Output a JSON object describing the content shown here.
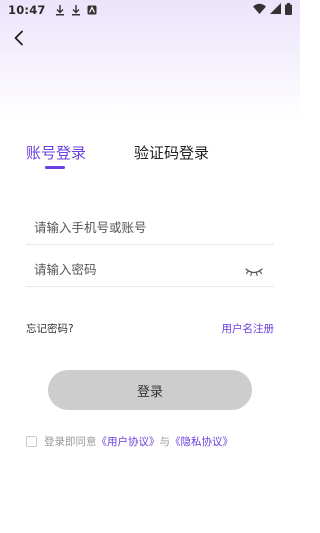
{
  "status_bar": {
    "time": "10:47",
    "left_icons": [
      "download-icon",
      "download-icon",
      "app-notification-icon"
    ],
    "right_icons": [
      "wifi-icon",
      "signal-icon",
      "battery-icon"
    ]
  },
  "nav": {
    "back_icon": "chevron-left-icon"
  },
  "tabs": [
    {
      "label": "账号登录",
      "active": true
    },
    {
      "label": "验证码登录",
      "active": false
    }
  ],
  "form": {
    "phone_placeholder": "请输入手机号或账号",
    "phone_value": "",
    "password_placeholder": "请输入密码",
    "password_value": "",
    "password_toggle_icon": "eye-closed-icon"
  },
  "links": {
    "forgot_password": "忘记密码?",
    "register": "用户名注册"
  },
  "login_button": {
    "label": "登录"
  },
  "agreement": {
    "prefix": "登录即同意",
    "user_agreement": "《用户协议》",
    "connector": "与",
    "privacy_policy": "《隐私协议》",
    "checked": false
  },
  "colors": {
    "accent": "#6a3fe0",
    "button_disabled": "#cdcdcd",
    "header_gradient_top": "#ece4fb"
  }
}
